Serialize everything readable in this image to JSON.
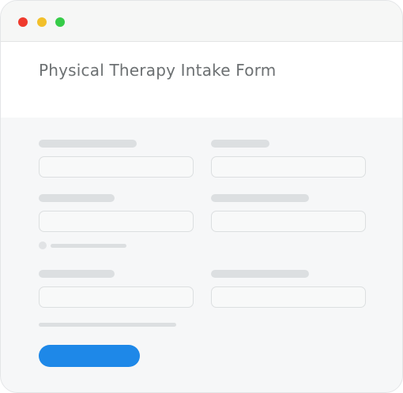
{
  "window": {
    "controls": [
      {
        "name": "close",
        "color": "#ef3a2d"
      },
      {
        "name": "minimize",
        "color": "#f2c02a"
      },
      {
        "name": "maximize",
        "color": "#36cc48"
      }
    ]
  },
  "form": {
    "title": "Physical Therapy Intake Form"
  },
  "colors": {
    "accent": "#1e88e8",
    "placeholder_bar": "#dcdfe1",
    "field_border": "#dcdfe0"
  }
}
